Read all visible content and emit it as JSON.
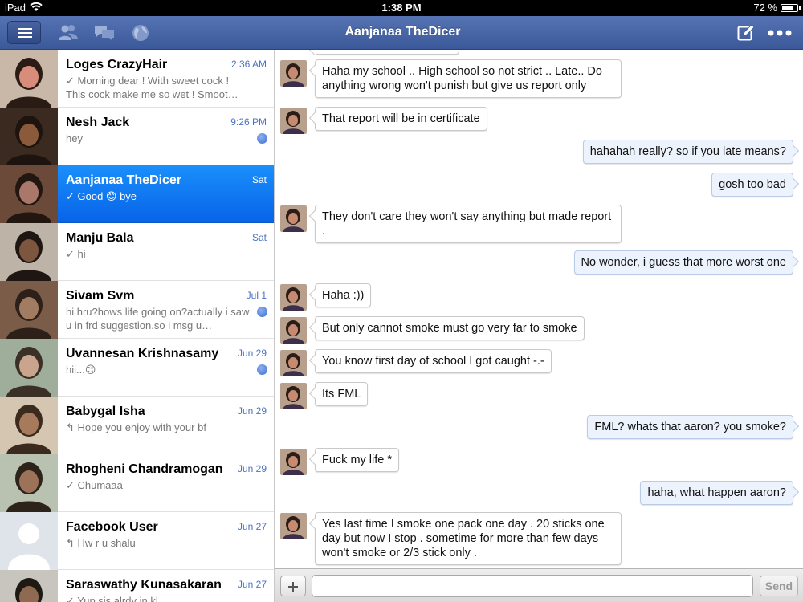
{
  "status_bar": {
    "device": "iPad",
    "time": "1:38 PM",
    "battery": "72 %",
    "battery_level": 0.72
  },
  "nav": {
    "title": "Aanjanaa TheDicer"
  },
  "conversations": [
    {
      "name": "Loges CrazyHair",
      "date": "2:36 AM",
      "preview": "✓ Morning dear ! With sweet cock ! This cock make me so wet ! Smoot…",
      "unread": false,
      "selected": false
    },
    {
      "name": "Nesh Jack",
      "date": "9:26 PM",
      "preview": "hey",
      "unread": true,
      "selected": false
    },
    {
      "name": "Aanjanaa TheDicer",
      "date": "Sat",
      "preview": "✓ Good 😊 bye",
      "unread": false,
      "selected": true
    },
    {
      "name": "Manju Bala",
      "date": "Sat",
      "preview": "✓ hi",
      "unread": false,
      "selected": false
    },
    {
      "name": "Sivam Svm",
      "date": "Jul 1",
      "preview": "hi hru?hows life going on?actually i saw u in frd suggestion.so i msg u…",
      "unread": true,
      "selected": false
    },
    {
      "name": "Uvannesan Krishnasamy",
      "date": "Jun 29",
      "preview": "hii...😊",
      "unread": true,
      "selected": false
    },
    {
      "name": "Babygal Isha",
      "date": "Jun 29",
      "preview": "↰ Hope you enjoy with your bf",
      "unread": false,
      "selected": false
    },
    {
      "name": "Rhogheni Chandramogan",
      "date": "Jun 29",
      "preview": "✓ Chumaaa",
      "unread": false,
      "selected": false
    },
    {
      "name": "Facebook User",
      "date": "Jun 27",
      "preview": "↰ Hw r u shalu",
      "unread": false,
      "selected": false
    },
    {
      "name": "Saraswathy Kunasakaran",
      "date": "Jun 27",
      "preview": "✓ Yup sis alrdy in kl",
      "unread": false,
      "selected": false
    }
  ],
  "messages": [
    {
      "from": "them",
      "text": "Haha my school .. High school so not strict .. Late.. Do anything wrong won't punish but give us report only"
    },
    {
      "from": "them",
      "text": "That report will be in certificate"
    },
    {
      "from": "me",
      "text": "hahahah really? so if you late means?"
    },
    {
      "from": "me",
      "text": "gosh too bad"
    },
    {
      "from": "them",
      "text": "They don't care they won't say anything but made report ."
    },
    {
      "from": "me",
      "text": "No wonder, i guess that more worst one"
    },
    {
      "from": "them",
      "text": "Haha :))"
    },
    {
      "from": "them",
      "text": "But only cannot smoke must go very far to smoke"
    },
    {
      "from": "them",
      "text": "You know first day of school I got caught -.-"
    },
    {
      "from": "them",
      "text": "Its FML"
    },
    {
      "from": "me",
      "text": "FML? whats that aaron? you smoke?"
    },
    {
      "from": "them",
      "text": "Fuck my life *"
    },
    {
      "from": "me",
      "text": "haha, what happen aaron?"
    },
    {
      "from": "them",
      "text": "Yes last time I smoke one pack one day . 20 sticks one day but now I stop . sometime for more than few days won't smoke or 2/3 stick only ."
    }
  ],
  "compose": {
    "input_value": "",
    "send_label": "Send"
  },
  "colors": {
    "brand": "#3b5998",
    "selected": "#1a8ffb",
    "date": "#4a73c5",
    "outgoing_bubble": "#edf3fc"
  },
  "icons": {
    "menu": "menu-icon",
    "friends": "friends-icon",
    "messages": "messages-icon",
    "globe": "globe-icon",
    "compose": "compose-icon",
    "more": "more-icon",
    "add": "plus-icon"
  }
}
